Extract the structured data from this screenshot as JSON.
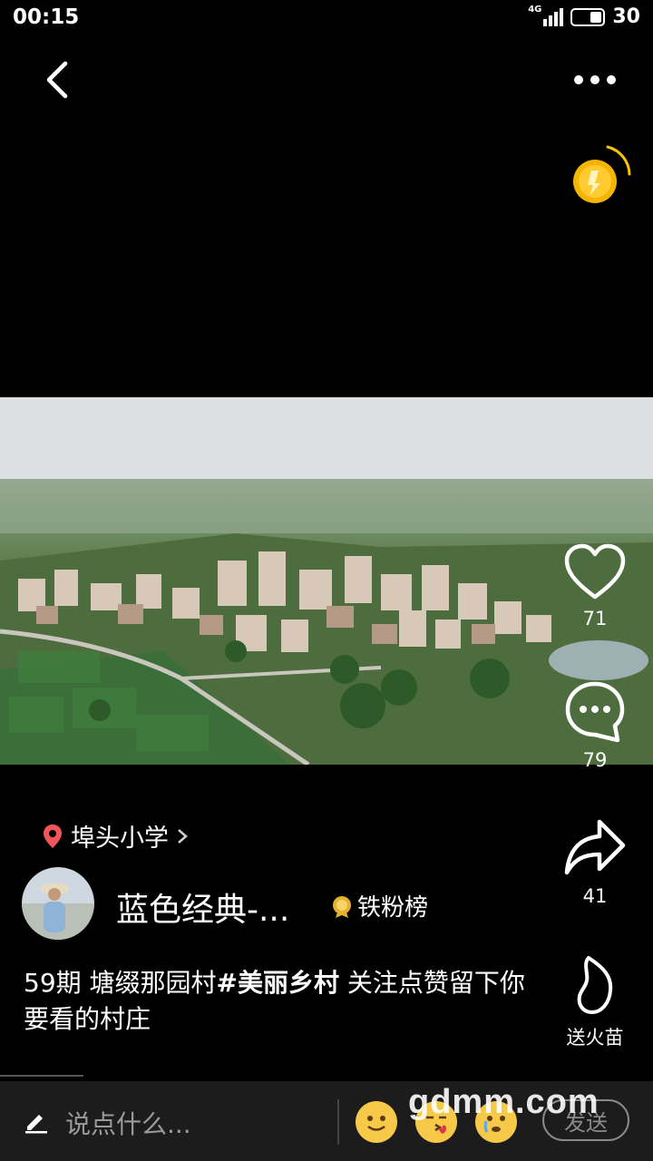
{
  "status_bar": {
    "time": "00:15",
    "network": "4G",
    "battery": "30"
  },
  "actions": {
    "likes": "71",
    "comments": "79",
    "shares": "41",
    "fire_label": "送火苗"
  },
  "location": {
    "name": "埠头小学"
  },
  "author": {
    "name": "蓝色经典-...",
    "fan_rank": "铁粉榜"
  },
  "caption": {
    "part1": "59期 塘缀那园村",
    "hashtag": "#美丽乡村",
    "part2": " 关注点赞留下你要看的村庄"
  },
  "input": {
    "placeholder": "说点什么...",
    "send_label": "发送"
  },
  "watermark": "gdmm.com",
  "colors": {
    "background": "#000000",
    "location_pin": "#f0555b",
    "coin": "#f5b400"
  }
}
